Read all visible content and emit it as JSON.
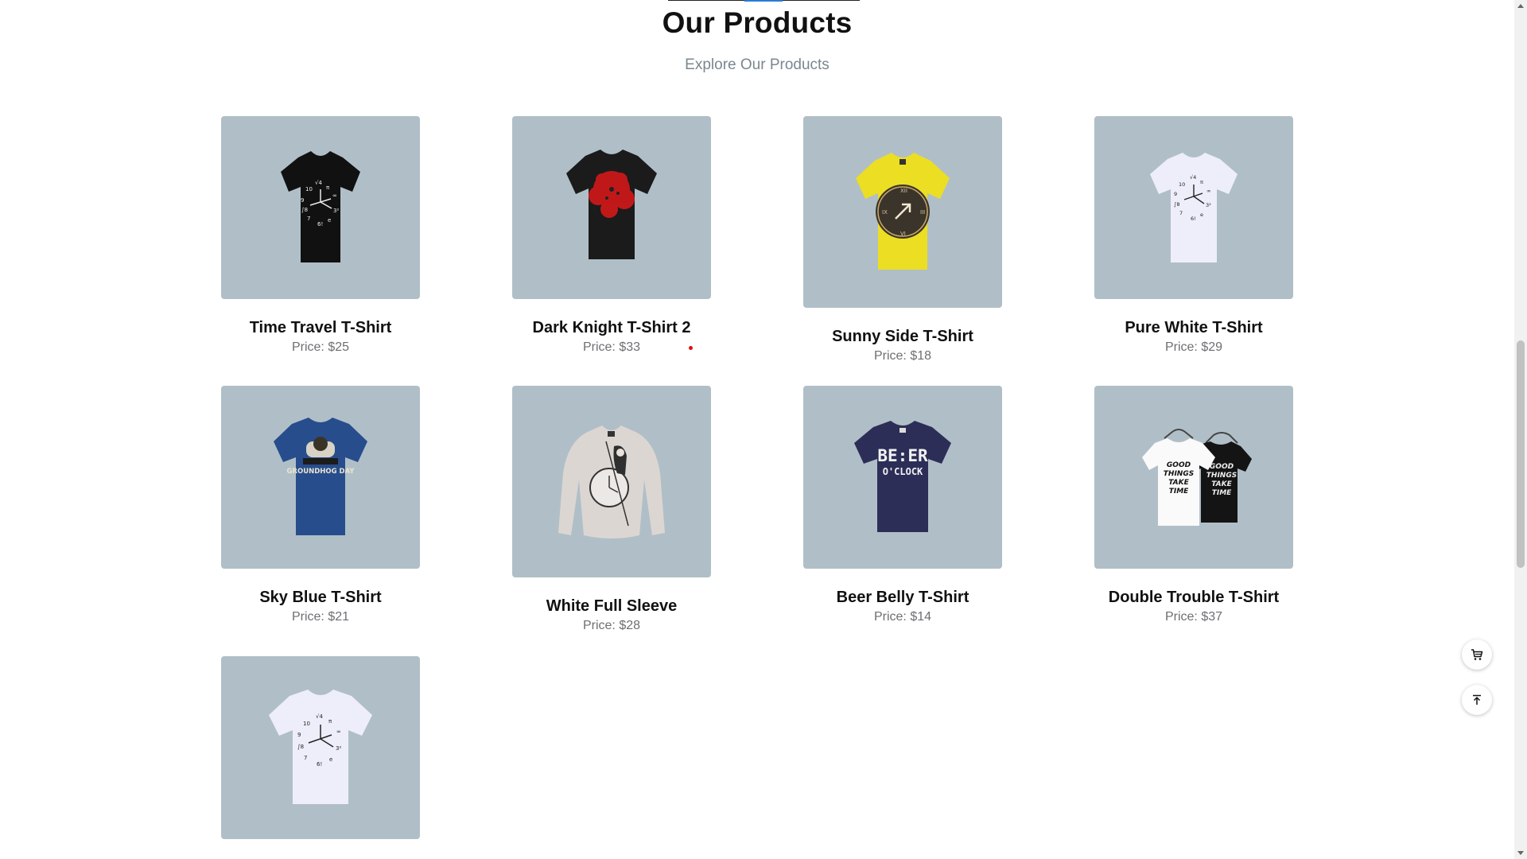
{
  "section": {
    "title": "Our Products",
    "subtitle": "Explore Our Products"
  },
  "products": [
    {
      "name": "Time Travel T-Shirt",
      "price": "Price: $25",
      "image": "black-tshirt-clock-icon"
    },
    {
      "name": "Dark Knight T-Shirt 2",
      "price": "Price: $33",
      "image": "black-tshirt-red-splatter-icon"
    },
    {
      "name": "Sunny Side T-Shirt",
      "price": "Price: $18",
      "image": "yellow-tshirt-clock-icon"
    },
    {
      "name": "Pure White T-Shirt",
      "price": "Price: $29",
      "image": "white-tshirt-clock-icon"
    },
    {
      "name": "Sky Blue T-Shirt",
      "price": "Price: $21",
      "image": "blue-tshirt-groundhog-icon"
    },
    {
      "name": "White Full Sleeve",
      "price": "Price: $28",
      "image": "white-sweatshirt-reaper-clock-icon"
    },
    {
      "name": "Beer Belly T-Shirt",
      "price": "Price: $14",
      "image": "navy-tshirt-beer-oclock-icon"
    },
    {
      "name": "Double Trouble T-Shirt",
      "price": "Price: $37",
      "image": "two-tshirts-good-things-icon"
    },
    {
      "name": "",
      "price": "",
      "image": "white-tshirt-clock-icon"
    }
  ],
  "print_text": {
    "beer": "BE:ER",
    "oclock": "O'CLOCK",
    "good_things": [
      "GOOD",
      "THINGS",
      "TAKE",
      "TIME"
    ],
    "groundhog": "GROUNDHOG DAY"
  },
  "floating_buttons": {
    "cart": "cart-icon",
    "back_to_top": "arrow-up-to-top-icon"
  },
  "colors": {
    "card_background": "#b0bfc7",
    "subtitle": "#7a8790",
    "price": "#6d6f72",
    "accent": "#2b7bd6"
  }
}
